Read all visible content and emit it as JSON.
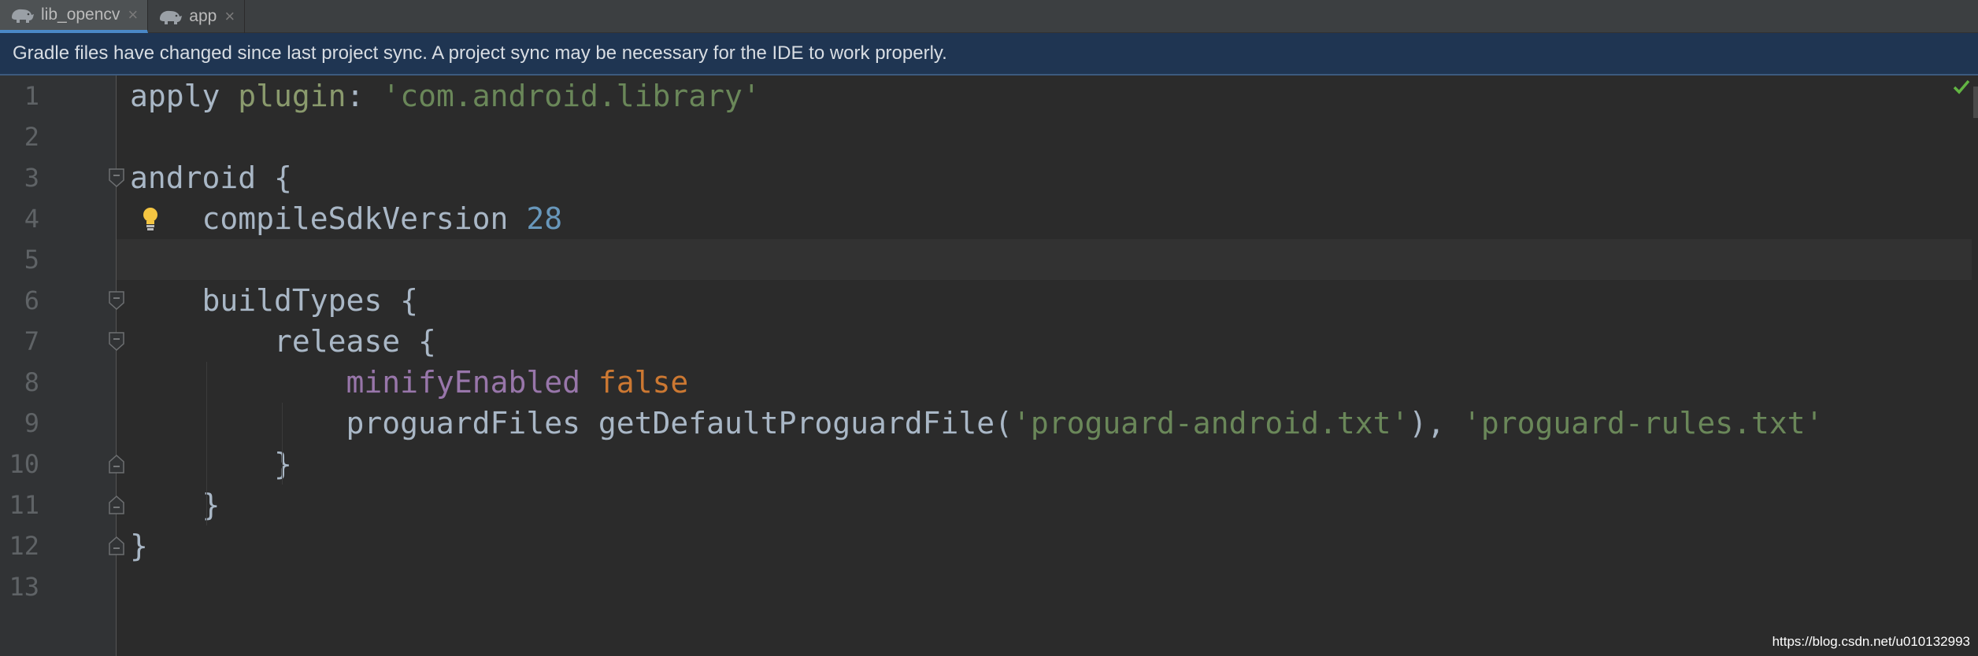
{
  "tabs": [
    {
      "label": "lib_opencv",
      "icon": "gradle-elephant-icon",
      "active": true
    },
    {
      "label": "app",
      "icon": "gradle-elephant-icon",
      "active": false
    }
  ],
  "banner": {
    "message": "Gradle files have changed since last project sync. A project sync may be necessary for the IDE to work properly."
  },
  "editor": {
    "line_numbers": [
      "1",
      "2",
      "3",
      "4",
      "5",
      "6",
      "7",
      "8",
      "9",
      "10",
      "11",
      "12",
      "13"
    ],
    "current_line": 5,
    "lines": [
      {
        "n": 1,
        "parts": [
          {
            "t": "apply ",
            "c": "plain"
          },
          {
            "t": "plugin",
            "c": "kw-plugin"
          },
          {
            "t": ": ",
            "c": "plain"
          },
          {
            "t": "'com.android.library'",
            "c": "str"
          }
        ]
      },
      {
        "n": 2,
        "parts": []
      },
      {
        "n": 3,
        "parts": [
          {
            "t": "android {",
            "c": "plain"
          }
        ]
      },
      {
        "n": 4,
        "parts": [
          {
            "t": "    compileSdkVersion ",
            "c": "plain"
          },
          {
            "t": "28",
            "c": "num"
          }
        ]
      },
      {
        "n": 5,
        "parts": []
      },
      {
        "n": 6,
        "parts": [
          {
            "t": "    buildTypes {",
            "c": "plain"
          }
        ]
      },
      {
        "n": 7,
        "parts": [
          {
            "t": "        release {",
            "c": "plain"
          }
        ]
      },
      {
        "n": 8,
        "parts": [
          {
            "t": "            ",
            "c": "plain"
          },
          {
            "t": "minifyEnabled",
            "c": "prop"
          },
          {
            "t": " ",
            "c": "plain"
          },
          {
            "t": "false",
            "c": "bool"
          }
        ]
      },
      {
        "n": 9,
        "parts": [
          {
            "t": "            proguardFiles getDefaultProguardFile(",
            "c": "plain"
          },
          {
            "t": "'proguard-android.txt'",
            "c": "str"
          },
          {
            "t": "), ",
            "c": "plain"
          },
          {
            "t": "'proguard-rules.txt'",
            "c": "str"
          }
        ]
      },
      {
        "n": 10,
        "parts": [
          {
            "t": "        }",
            "c": "plain"
          }
        ]
      },
      {
        "n": 11,
        "parts": [
          {
            "t": "    }",
            "c": "plain"
          }
        ]
      },
      {
        "n": 12,
        "parts": [
          {
            "t": "}",
            "c": "plain"
          }
        ]
      },
      {
        "n": 13,
        "parts": []
      }
    ],
    "fold_lines": [
      3,
      6,
      7,
      10,
      11,
      12
    ],
    "bulb_line": 4,
    "status_icon": "check-icon"
  },
  "colors": {
    "background": "#2b2b2b",
    "text": "#a9b7c6",
    "string": "#6a8759",
    "number": "#6897bb",
    "property": "#9876aa",
    "keyword": "#cc7832",
    "banner": "#1f3552"
  },
  "watermark": "https://blog.csdn.net/u010132993"
}
